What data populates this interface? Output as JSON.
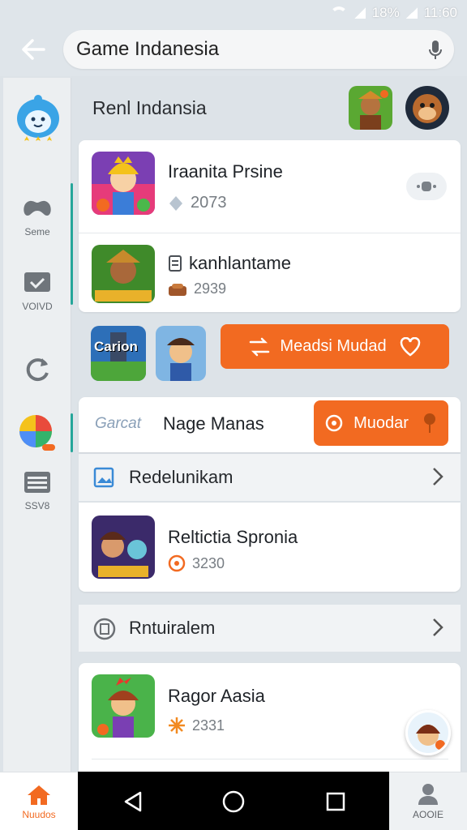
{
  "status": {
    "battery": "18%",
    "time": "11:60"
  },
  "search": {
    "value": "Game Indanesia"
  },
  "sidebar": {
    "items": [
      {
        "label": "Seme"
      },
      {
        "label": "VOIVD"
      },
      {
        "label": ""
      },
      {
        "label": ""
      },
      {
        "label": "SSV8"
      }
    ]
  },
  "profile": {
    "name": "Renl Indansia"
  },
  "list1": [
    {
      "title": "Iraanita Prsine",
      "meta": "2073"
    },
    {
      "title": "kanhlantame",
      "meta": "2939"
    }
  ],
  "promo": {
    "thumb1_text": "Carion",
    "thumb2_text": "",
    "button": "Meadsi Mudad"
  },
  "section_tabs": {
    "tab1": "Garcat",
    "tab2": "Nage Manas",
    "button": "Muodar"
  },
  "section_a": {
    "title": "Redelunikam"
  },
  "item_a": {
    "title": "Reltictia Spronia",
    "meta": "3230"
  },
  "section_b": {
    "title": "Rntuiralem"
  },
  "item_b": {
    "title": "Ragor Aasia",
    "meta": "2331"
  },
  "bottom": {
    "left_label": "Nuudos",
    "right_label": "AOOIE"
  },
  "colors": {
    "accent": "#f26a21",
    "teal": "#26a69a",
    "background": "#dde3e8"
  }
}
